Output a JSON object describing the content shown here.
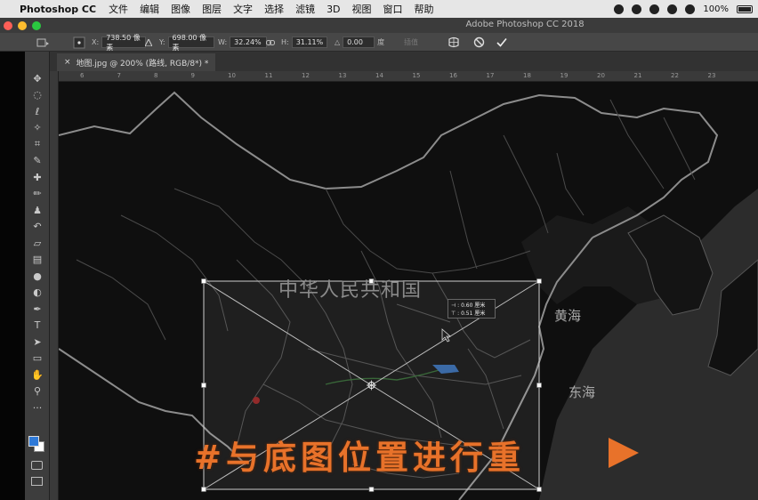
{
  "menubar": {
    "apple": "",
    "app_name": "Photoshop CC",
    "items": [
      "文件",
      "编辑",
      "图像",
      "图层",
      "文字",
      "选择",
      "滤镜",
      "3D",
      "视图",
      "窗口",
      "帮助"
    ],
    "battery": "100%"
  },
  "window": {
    "title": "Adobe Photoshop CC 2018",
    "traffic_colors": [
      "#fd5f57",
      "#febc2e",
      "#2ac840"
    ]
  },
  "options": {
    "x_label": "X:",
    "x_value": "738.50 像素",
    "y_label": "Y:",
    "y_value": "698.00 像素",
    "w_label": "W:",
    "w_value": "32.24%",
    "h_label": "H:",
    "h_value": "31.11%",
    "angle_label": "△",
    "angle_value": "0.00",
    "angle_unit": "度",
    "interp": "插值",
    "warp_icon": "warp-icon",
    "cancel_icon": "cancel-icon",
    "commit_icon": "commit-icon"
  },
  "tab": {
    "label": "地图.jpg @ 200% (路线, RGB/8*) *",
    "close": "×"
  },
  "ruler": {
    "top_ticks": [
      "6",
      "7",
      "8",
      "9",
      "10",
      "11",
      "12",
      "13",
      "14",
      "15",
      "16",
      "17",
      "18",
      "19",
      "20",
      "21",
      "22",
      "23"
    ]
  },
  "tools": [
    {
      "name": "move-tool-icon",
      "glyph": "✥"
    },
    {
      "name": "marquee-tool-icon",
      "glyph": "◌"
    },
    {
      "name": "lasso-tool-icon",
      "glyph": "ℓ"
    },
    {
      "name": "magic-wand-tool-icon",
      "glyph": "✧"
    },
    {
      "name": "crop-tool-icon",
      "glyph": "⌗"
    },
    {
      "name": "eyedropper-tool-icon",
      "glyph": "✎"
    },
    {
      "name": "healing-tool-icon",
      "glyph": "✚"
    },
    {
      "name": "brush-tool-icon",
      "glyph": "✏"
    },
    {
      "name": "stamp-tool-icon",
      "glyph": "♟"
    },
    {
      "name": "history-brush-tool-icon",
      "glyph": "↶"
    },
    {
      "name": "eraser-tool-icon",
      "glyph": "▱"
    },
    {
      "name": "gradient-tool-icon",
      "glyph": "▤"
    },
    {
      "name": "blur-tool-icon",
      "glyph": "●"
    },
    {
      "name": "dodge-tool-icon",
      "glyph": "◐"
    },
    {
      "name": "pen-tool-icon",
      "glyph": "✒"
    },
    {
      "name": "type-tool-icon",
      "glyph": "T"
    },
    {
      "name": "path-select-tool-icon",
      "glyph": "➤"
    },
    {
      "name": "rectangle-tool-icon",
      "glyph": "▭"
    },
    {
      "name": "hand-tool-icon",
      "glyph": "✋"
    },
    {
      "name": "zoom-tool-icon",
      "glyph": "⚲"
    },
    {
      "name": "more-tools-icon",
      "glyph": "···"
    }
  ],
  "colors": {
    "foreground": "#2f7ad8",
    "background": "#ffffff"
  },
  "map": {
    "country_label": "中华人民共和国",
    "sea_yellow": "黄海",
    "sea_east": "东海"
  },
  "tooltip": {
    "line1": "⊣ : 0.60 厘米",
    "line2": "⊤ : 0.51 厘米"
  },
  "caption": {
    "text": "#与底图位置进行重"
  }
}
